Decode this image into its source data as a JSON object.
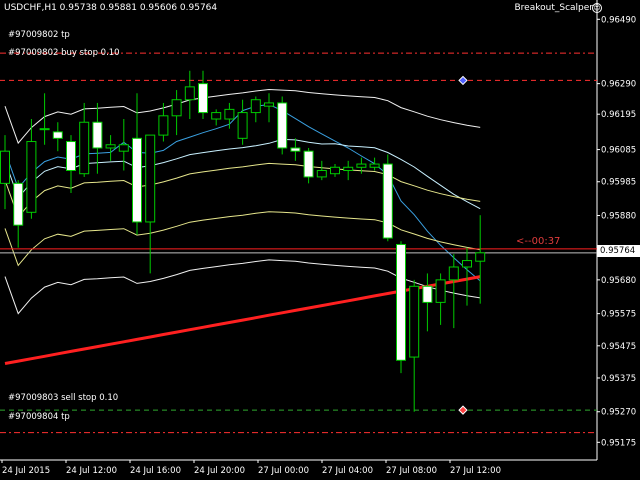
{
  "header": {
    "symbol_info": "USDCHF,H1  0.95738 0.95881 0.95606 0.95764",
    "ea_name": "Breakout_Scalper",
    "ea_icon": "smiley-icon"
  },
  "orders": [
    {
      "label": "#97009802 tp",
      "price": 0.96385,
      "color": "#ff3030",
      "style": "dash-dot"
    },
    {
      "label": "#97009802 buy stop 0.10",
      "price": 0.963,
      "color": "#ff3030",
      "style": "dash"
    },
    {
      "label": "#97009803 sell stop 0.10",
      "price": 0.95275,
      "color": "#2fa82f",
      "style": "dash"
    },
    {
      "label": "#97009804 tp",
      "price": 0.95205,
      "color": "#ff3030",
      "style": "dash-dot"
    }
  ],
  "countdown": "<--00:37",
  "current_price": "0.95764",
  "price_axis": [
    "0.96490",
    "0.96290",
    "0.96195",
    "0.96085",
    "0.95985",
    "0.95880",
    "0.95680",
    "0.95575",
    "0.95475",
    "0.95375",
    "0.95270",
    "0.95175"
  ],
  "time_axis": [
    "24 Jul 2015",
    "24 Jul 12:00",
    "24 Jul 16:00",
    "24 Jul 20:00",
    "27 Jul 00:00",
    "27 Jul 04:00",
    "27 Jul 08:00",
    "27 Jul 12:00"
  ],
  "colors": {
    "bull_fill": "#000000",
    "bear_fill": "#ffffff",
    "candle_outline": "#00cc00",
    "ma_red": "#ff2020",
    "ma_blue": "#3aa0e0",
    "ma_light": "#c8f0ff",
    "band_yellow": "#e6e68c",
    "band_white": "#f0f0f0"
  },
  "chart_data": {
    "type": "candlestick",
    "symbol": "USDCHF",
    "timeframe": "H1",
    "ylim": [
      0.9512,
      0.9655
    ],
    "candles": [
      {
        "o": 0.9598,
        "h": 0.9613,
        "l": 0.959,
        "c": 0.9608
      },
      {
        "o": 0.9598,
        "h": 0.9599,
        "l": 0.9578,
        "c": 0.9585
      },
      {
        "o": 0.9589,
        "h": 0.9618,
        "l": 0.9587,
        "c": 0.9611
      },
      {
        "o": 0.9615,
        "h": 0.9626,
        "l": 0.961,
        "c": 0.9615
      },
      {
        "o": 0.9614,
        "h": 0.9617,
        "l": 0.9608,
        "c": 0.9612
      },
      {
        "o": 0.9611,
        "h": 0.9613,
        "l": 0.9595,
        "c": 0.9602
      },
      {
        "o": 0.9601,
        "h": 0.9623,
        "l": 0.96,
        "c": 0.9617
      },
      {
        "o": 0.9617,
        "h": 0.9623,
        "l": 0.9601,
        "c": 0.9609
      },
      {
        "o": 0.9609,
        "h": 0.9613,
        "l": 0.9605,
        "c": 0.961
      },
      {
        "o": 0.9608,
        "h": 0.9618,
        "l": 0.9602,
        "c": 0.961
      },
      {
        "o": 0.9612,
        "h": 0.9626,
        "l": 0.9582,
        "c": 0.9586
      },
      {
        "o": 0.9586,
        "h": 0.9613,
        "l": 0.957,
        "c": 0.9613
      },
      {
        "o": 0.9613,
        "h": 0.9623,
        "l": 0.9611,
        "c": 0.9619
      },
      {
        "o": 0.9619,
        "h": 0.9627,
        "l": 0.9613,
        "c": 0.9624
      },
      {
        "o": 0.9624,
        "h": 0.9633,
        "l": 0.9618,
        "c": 0.9628
      },
      {
        "o": 0.9629,
        "h": 0.9633,
        "l": 0.9618,
        "c": 0.962
      },
      {
        "o": 0.9618,
        "h": 0.9621,
        "l": 0.9616,
        "c": 0.962
      },
      {
        "o": 0.9618,
        "h": 0.9623,
        "l": 0.9615,
        "c": 0.9621
      },
      {
        "o": 0.9612,
        "h": 0.9624,
        "l": 0.961,
        "c": 0.962
      },
      {
        "o": 0.962,
        "h": 0.9625,
        "l": 0.9617,
        "c": 0.9624
      },
      {
        "o": 0.9622,
        "h": 0.9626,
        "l": 0.9617,
        "c": 0.9623
      },
      {
        "o": 0.9623,
        "h": 0.9625,
        "l": 0.9607,
        "c": 0.9609
      },
      {
        "o": 0.9609,
        "h": 0.9612,
        "l": 0.9605,
        "c": 0.9608
      },
      {
        "o": 0.9608,
        "h": 0.9609,
        "l": 0.9598,
        "c": 0.96
      },
      {
        "o": 0.96,
        "h": 0.9605,
        "l": 0.9599,
        "c": 0.9602
      },
      {
        "o": 0.9601,
        "h": 0.9604,
        "l": 0.96,
        "c": 0.9603
      },
      {
        "o": 0.9602,
        "h": 0.9605,
        "l": 0.9599,
        "c": 0.9603
      },
      {
        "o": 0.9603,
        "h": 0.9606,
        "l": 0.9601,
        "c": 0.9604
      },
      {
        "o": 0.9603,
        "h": 0.9606,
        "l": 0.9602,
        "c": 0.9604
      },
      {
        "o": 0.9604,
        "h": 0.9607,
        "l": 0.958,
        "c": 0.9581
      },
      {
        "o": 0.9579,
        "h": 0.958,
        "l": 0.9539,
        "c": 0.9543
      },
      {
        "o": 0.9544,
        "h": 0.9568,
        "l": 0.9527,
        "c": 0.9566
      },
      {
        "o": 0.9566,
        "h": 0.957,
        "l": 0.9552,
        "c": 0.9561
      },
      {
        "o": 0.9561,
        "h": 0.957,
        "l": 0.9554,
        "c": 0.9568
      },
      {
        "o": 0.9568,
        "h": 0.9576,
        "l": 0.9553,
        "c": 0.9572
      },
      {
        "o": 0.9572,
        "h": 0.9578,
        "l": 0.956,
        "c": 0.9574
      },
      {
        "o": 0.95738,
        "h": 0.95881,
        "l": 0.95606,
        "c": 0.95764
      }
    ]
  }
}
